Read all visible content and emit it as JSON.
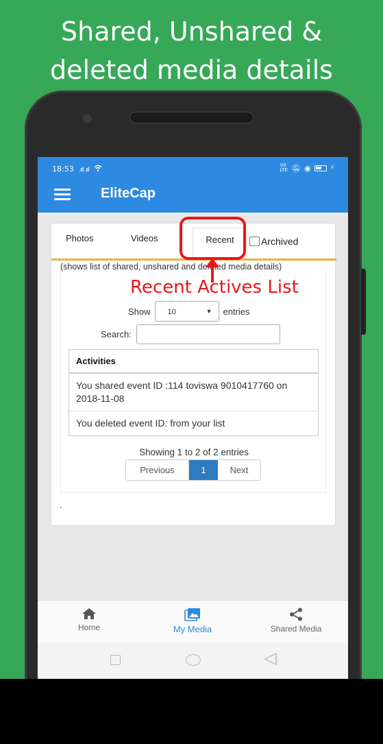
{
  "headline": {
    "line1": "Shared, Unshared &",
    "line2": "deleted media details"
  },
  "status_bar": {
    "time": "18:53",
    "signal": ".ııl .ııl",
    "right_icons": "⋮ •"
  },
  "app_bar": {
    "title": "EliteCap"
  },
  "tabs": {
    "photos": "Photos",
    "videos": "Videos",
    "recent": "Recent",
    "archived": "Archived"
  },
  "content": {
    "description": "(shows list of shared, unshared and deleted media details)",
    "show_label": "Show",
    "entries_value": "10",
    "entries_label": "entries",
    "search_label": "Search:",
    "search_value": "",
    "table_header": "Activities",
    "rows": [
      "You shared event ID :114 toviswa 9010417760 on 2018-11-08",
      "You deleted event ID: from your list"
    ],
    "info": "Showing 1 to 2 of 2 entries",
    "pager": {
      "previous": "Previous",
      "page": "1",
      "next": "Next"
    },
    "dot": "."
  },
  "annotation": {
    "text": "Recent Actives List"
  },
  "bottom_nav": {
    "home": "Home",
    "my_media": "My Media",
    "shared_media": "Shared Media"
  },
  "colors": {
    "background": "#36a858",
    "app_bar": "#2d8ae0",
    "annotation": "#e8171a",
    "tab_underline": "#f0ad3e",
    "active_page": "#2f7bbf"
  },
  "icons": [
    "menu-icon",
    "wifi-icon",
    "battery-icon",
    "home-icon",
    "photo-library-icon",
    "share-icon",
    "dropdown-arrow-icon"
  ]
}
